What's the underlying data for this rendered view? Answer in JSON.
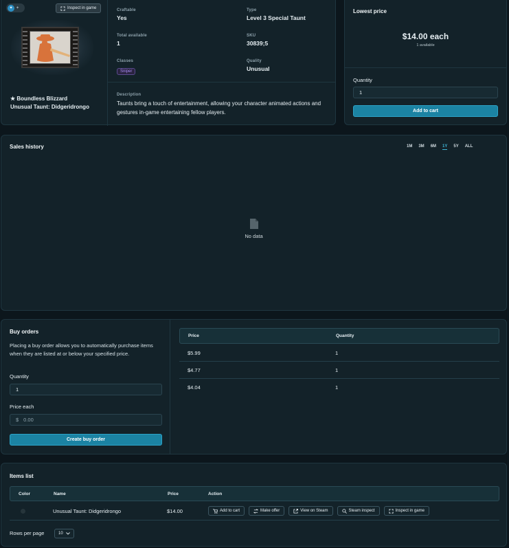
{
  "item": {
    "inspect_label": "Inspect in game",
    "name_line1": "★ Boundless Blizzard",
    "name_line2": "Unusual Taunt: Didgeridrongo",
    "details": {
      "craftable_label": "Craftable",
      "craftable_value": "Yes",
      "type_label": "Type",
      "type_value": "Level 3 Special Taunt",
      "total_label": "Total available",
      "total_value": "1",
      "sku_label": "SKU",
      "sku_value": "30839;5",
      "classes_label": "Classes",
      "classes_value": "Sniper",
      "quality_label": "Quality",
      "quality_value": "Unusual",
      "description_label": "Description",
      "description_value": "Taunts bring a touch of entertainment, allowing your character animated actions and gestures in-game entertaining fellow players."
    }
  },
  "price_box": {
    "title": "Lowest price",
    "price": "$14.00 each",
    "available": "1 available",
    "quantity_label": "Quantity",
    "quantity_value": "1",
    "add_to_cart": "Add to cart"
  },
  "sales_history": {
    "title": "Sales history",
    "ranges": [
      "1M",
      "3M",
      "6M",
      "1Y",
      "5Y",
      "ALL"
    ],
    "active_range": "1Y",
    "empty_text": "No data"
  },
  "buy_orders": {
    "title": "Buy orders",
    "description": "Placing a buy order allows you to automatically purchase items when they are listed at or below your specified price.",
    "quantity_label": "Quantity",
    "quantity_value": "1",
    "price_label": "Price each",
    "price_currency": "$",
    "price_placeholder": "0.00",
    "create_button": "Create buy order",
    "table": {
      "headers": [
        "Price",
        "Quantity"
      ],
      "rows": [
        {
          "price": "$5.99",
          "quantity": "1"
        },
        {
          "price": "$4.77",
          "quantity": "1"
        },
        {
          "price": "$4.04",
          "quantity": "1"
        }
      ]
    }
  },
  "items_list": {
    "title": "Items list",
    "headers": [
      "Color",
      "Name",
      "Price",
      "Action"
    ],
    "rows": [
      {
        "name": "Unusual Taunt: Didgeridrongo",
        "price": "$14.00"
      }
    ],
    "actions": [
      "Add to cart",
      "Make offer",
      "View on Steam",
      "Steam inspect",
      "Inspect in game"
    ],
    "rows_per_page_label": "Rows per page",
    "rows_per_page_value": "10"
  },
  "colors": {
    "accent": "#1b83a3",
    "panel": "#132229",
    "badge_purple": "#8b5cf6"
  }
}
